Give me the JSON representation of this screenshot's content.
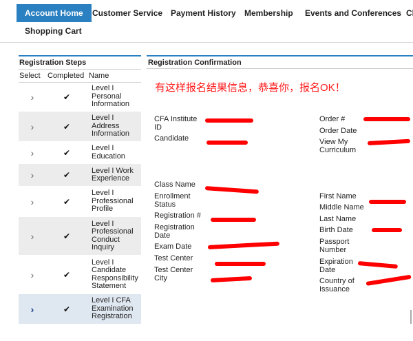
{
  "nav": {
    "tabs": [
      {
        "label": "Account Home",
        "active": true
      },
      {
        "label": "Customer Service"
      },
      {
        "label": "Payment History"
      },
      {
        "label": "Membership"
      },
      {
        "label": "Events and Conferences"
      },
      {
        "label": "Cl"
      }
    ],
    "row2": "Shopping Cart"
  },
  "steps_panel": {
    "title": "Registration Steps",
    "col_select": "Select",
    "col_completed": "Completed",
    "col_name": "Name",
    "steps": [
      {
        "name": "Level I\nPersonal\nInformation",
        "completed": "✔"
      },
      {
        "name": "Level I\nAddress\nInformation",
        "completed": "✔"
      },
      {
        "name": "Level I\nEducation",
        "completed": "✔"
      },
      {
        "name": "Level I Work\nExperience",
        "completed": "✔"
      },
      {
        "name": "Level I\nProfessional\nProfile",
        "completed": "✔"
      },
      {
        "name": "Level I\nProfessional\nConduct\nInquiry",
        "completed": "✔"
      },
      {
        "name": "Level I\nCandidate\nResponsibility\nStatement",
        "completed": "✔"
      },
      {
        "name": "Level I CFA\nExamination\nRegistration",
        "completed": "✔",
        "current": true
      }
    ]
  },
  "confirmation": {
    "title": "Registration Confirmation",
    "note": "有这样报名结果信息，恭喜你，报名OK！",
    "left_fields_top": [
      "CFA Institute\nID",
      "Candidate"
    ],
    "right_fields_top": [
      "Order #",
      "Order Date",
      "View My\nCurriculum"
    ],
    "left_fields": [
      "Class Name",
      "Enrollment\nStatus",
      "Registration #",
      "Registration\nDate",
      "Exam Date",
      "Test Center",
      "Test Center\nCity"
    ],
    "right_fields": [
      "First Name",
      "Middle Name",
      "Last Name",
      "Birth Date",
      "Passport\nNumber",
      "Expiration\nDate",
      "Country of\nIssuance"
    ]
  },
  "colors": {
    "accent": "#2b80c1",
    "redaction": "#ff0000",
    "note": "#ff1a1a"
  },
  "icons": {
    "select": "chevron-right-icon",
    "completed": "check-icon"
  }
}
